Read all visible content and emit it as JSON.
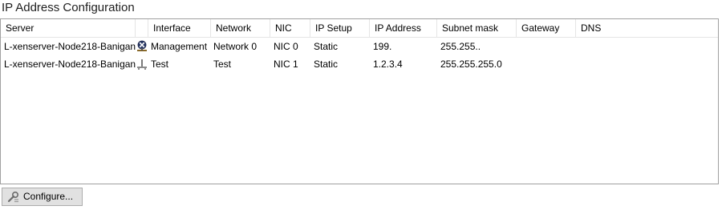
{
  "panel": {
    "title": "IP Address Configuration"
  },
  "grid": {
    "columns": [
      "Server",
      "",
      "Interface",
      "Network",
      "NIC",
      "IP Setup",
      "IP Address",
      "Subnet mask",
      "Gateway",
      "DNS"
    ],
    "rows": [
      {
        "server": "L-xenserver-Node218-Banigan",
        "icon": "management-interface-icon",
        "interface": "Management",
        "network": "Network 0",
        "nic": "NIC 0",
        "ip_setup": "Static",
        "ip_address": "199.",
        "subnet_mask": "255.255..",
        "gateway": "",
        "dns": ""
      },
      {
        "server": "L-xenserver-Node218-Banigan",
        "icon": "network-interface-icon",
        "interface": "Test",
        "network": "Test",
        "nic": "NIC 1",
        "ip_setup": "Static",
        "ip_address": "1.2.3.4",
        "subnet_mask": "255.255.255.0",
        "gateway": "",
        "dns": ""
      }
    ]
  },
  "actions": {
    "configure_label": "Configure..."
  }
}
